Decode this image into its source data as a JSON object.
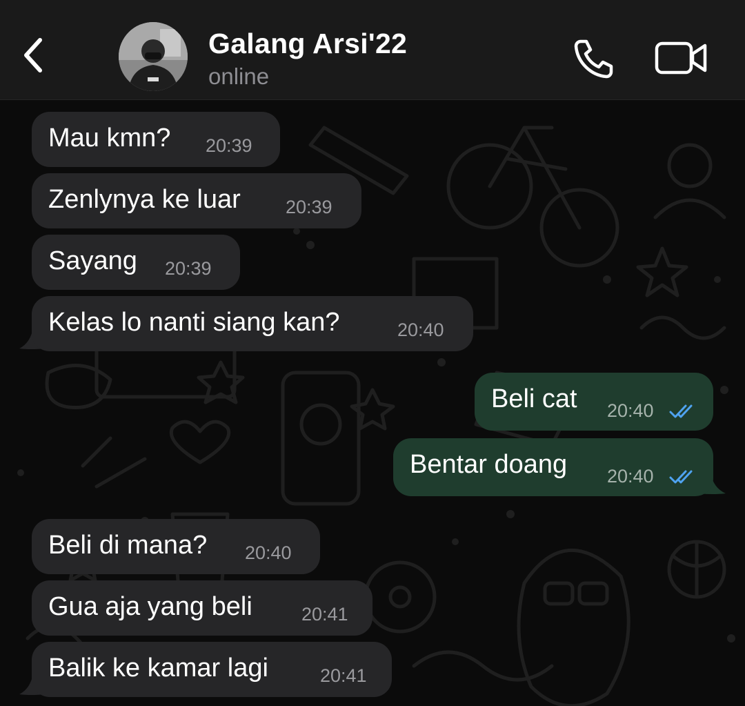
{
  "header": {
    "contact_name": "Galang Arsi'22",
    "status": "online",
    "back_icon": "chevron-left-icon",
    "call_icon": "phone-icon",
    "video_icon": "video-camera-icon"
  },
  "colors": {
    "header_bg": "#1a1a1a",
    "chat_bg": "#0b0b0b",
    "incoming_bubble": "#262628",
    "outgoing_bubble": "#1f3d2e",
    "read_ticks": "#4fa3f0"
  },
  "messages": [
    {
      "direction": "incoming",
      "text": "Mau kmn?",
      "time": "20:39"
    },
    {
      "direction": "incoming",
      "text": "Zenlynya ke luar",
      "time": "20:39"
    },
    {
      "direction": "incoming",
      "text": "Sayang",
      "time": "20:39"
    },
    {
      "direction": "incoming",
      "text": "Kelas lo nanti siang kan?",
      "time": "20:40"
    },
    {
      "direction": "outgoing",
      "text": "Beli cat",
      "time": "20:40",
      "status": "read"
    },
    {
      "direction": "outgoing",
      "text": "Bentar doang",
      "time": "20:40",
      "status": "read"
    },
    {
      "direction": "incoming",
      "text": "Beli di mana?",
      "time": "20:40"
    },
    {
      "direction": "incoming",
      "text": "Gua aja yang beli",
      "time": "20:41"
    },
    {
      "direction": "incoming",
      "text": "Balik ke kamar lagi",
      "time": "20:41"
    }
  ]
}
